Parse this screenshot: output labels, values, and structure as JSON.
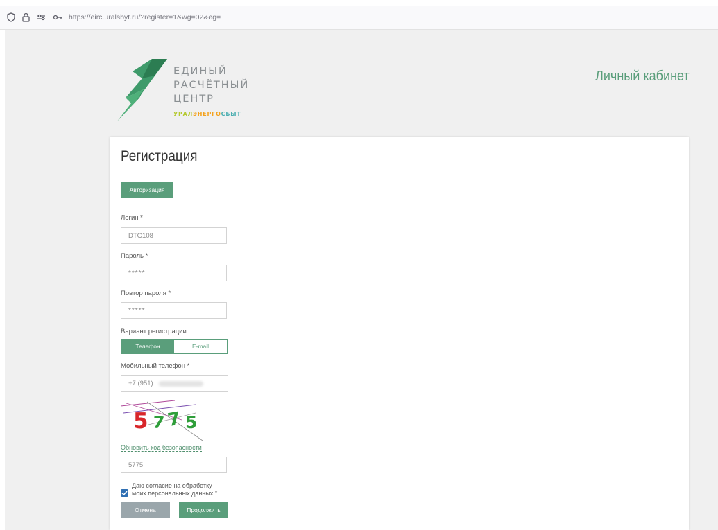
{
  "browser": {
    "url": "https://eirc.uralsbyt.ru/?register=1&wg=02&eg=",
    "icons": [
      "shield-icon",
      "lock-icon",
      "permissions-icon",
      "key-icon"
    ]
  },
  "header": {
    "logo_lines": [
      "ЕДИНЫЙ",
      "РАСЧЁТНЫЙ",
      "ЦЕНТР"
    ],
    "logo_brand_part1": "УРАЛ",
    "logo_brand_part2": "ЭНЕРГО",
    "logo_brand_part3": "СБЫТ",
    "cabinet_title": "Личный кабинет"
  },
  "form": {
    "title": "Регистрация",
    "auth_button": "Авторизация",
    "login": {
      "label": "Логин *",
      "value": "DTG108"
    },
    "password": {
      "label": "Пароль *",
      "value": "*****"
    },
    "password_repeat": {
      "label": "Повтор пароля *",
      "value": "*****"
    },
    "registration_variant": {
      "label": "Вариант регистрации",
      "options": [
        "Телефон",
        "E-mail"
      ],
      "selected": "Телефон"
    },
    "phone": {
      "label": "Мобильный телефон *",
      "prefix": "+7 (951)"
    },
    "captcha": {
      "code_image_text": "5775",
      "refresh_link": "Обновить код безопасности",
      "input_value": "5775"
    },
    "consent": {
      "checked": true,
      "line1": "Даю согласие на обработку",
      "line2": "моих персональных данных *"
    },
    "cancel_button": "Отмена",
    "continue_button": "Продолжить"
  },
  "colors": {
    "brand_green": "#5a9e7b",
    "cancel_gray": "#9aa6ab",
    "checkbox_blue": "#2f6fb3",
    "captcha_red": "#d8262a",
    "captcha_green": "#2f9e3a"
  }
}
